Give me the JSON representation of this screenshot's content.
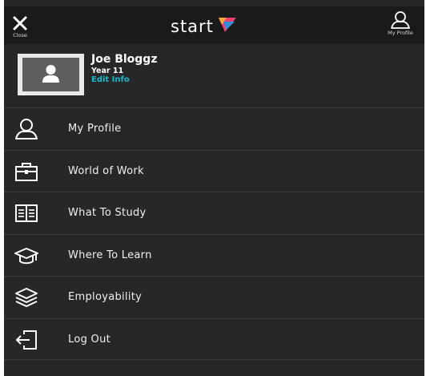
{
  "header": {
    "close_label": "Close",
    "logo_text": "start",
    "profile_label": "My Profile",
    "colors": {
      "background": "#1a1a1a",
      "logo_accent_primary": "#e94070",
      "logo_accent_secondary": "#2f8fd8"
    }
  },
  "user": {
    "name": "Joe Bloggz",
    "year": "Year 11",
    "edit_label": "Edit Info",
    "edit_color": "#19b9cc"
  },
  "menu": {
    "items": [
      {
        "label": "My Profile",
        "icon": "person-icon"
      },
      {
        "label": "World of Work",
        "icon": "briefcase-icon"
      },
      {
        "label": "What To Study",
        "icon": "book-icon"
      },
      {
        "label": "Where To Learn",
        "icon": "graduation-cap-icon"
      },
      {
        "label": "Employability",
        "icon": "layers-icon"
      },
      {
        "label": "Log Out",
        "icon": "logout-icon"
      }
    ]
  }
}
